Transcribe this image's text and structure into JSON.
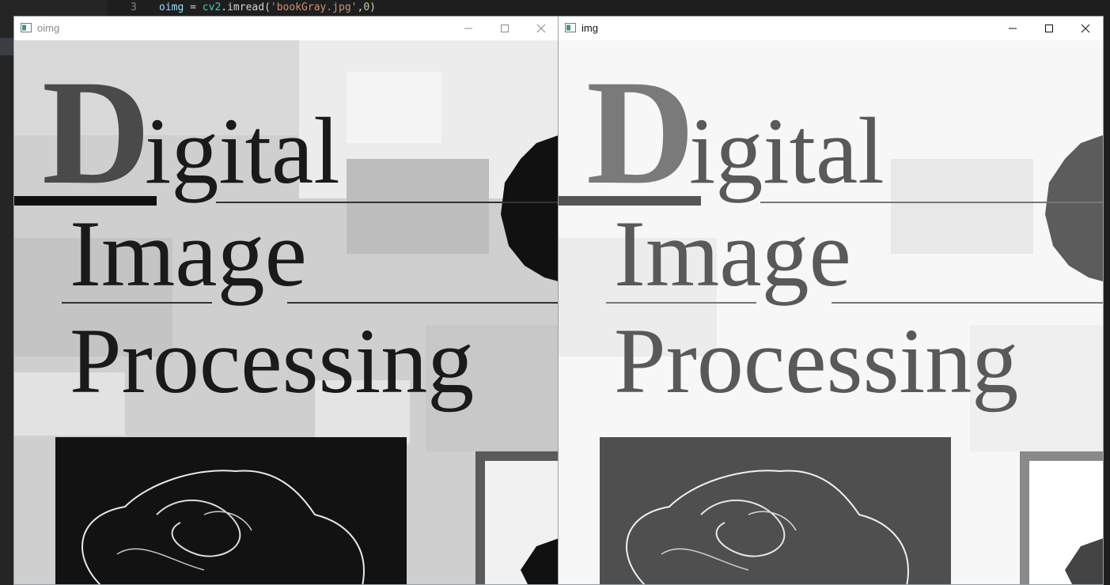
{
  "editor": {
    "line_number": "3",
    "code": {
      "var": "oimg",
      "op": " = ",
      "module": "cv2",
      "call": ".imread(",
      "str": "'bookGray.jpg'",
      "comma": ",",
      "num": "0",
      "close": ")"
    }
  },
  "windows": [
    {
      "title": "oimg",
      "buttons": [
        "minimize",
        "maximize",
        "close"
      ],
      "image": {
        "line1": "igital",
        "dropcap": "D",
        "line2": "Image",
        "line3": "Processing",
        "tone": "original"
      }
    },
    {
      "title": "img",
      "buttons": [
        "minimize",
        "maximize",
        "close"
      ],
      "image": {
        "line1": "igital",
        "dropcap": "D",
        "line2": "Image",
        "line3": "Processing",
        "tone": "processed"
      }
    }
  ],
  "colors": {
    "editor_bg": "#1e1e1e",
    "gutter_bg": "#252526",
    "window_border": "#9aa0a6"
  }
}
